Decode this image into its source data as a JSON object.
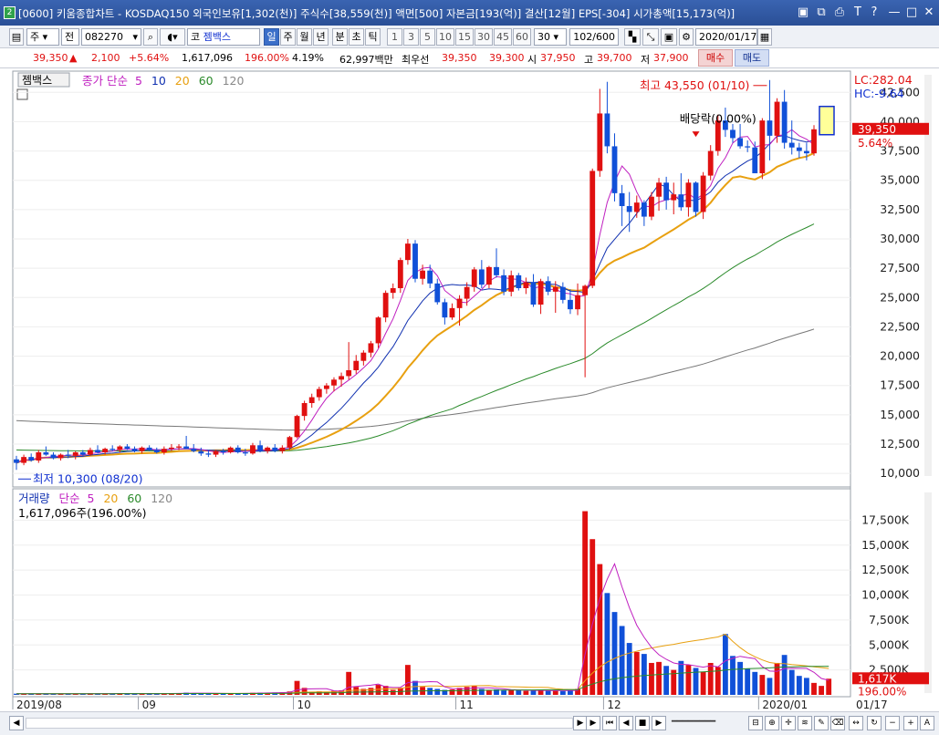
{
  "window": {
    "badge": "2",
    "title": "[0600] 키움종합차트 - KOSDAQ150 외국인보유[1,302(천)] 주식수[38,559(천)] 액면[500] 자본금[193(억)] 결산[12월] EPS[-304] 시가총액[15,173(억)]"
  },
  "toolbar": {
    "period_unit": "주",
    "compare": "전",
    "code": "082270",
    "market": "코",
    "stock_name": "젬백스",
    "periods": [
      "일",
      "주",
      "월",
      "년",
      "분",
      "초",
      "틱"
    ],
    "selected_period": "일",
    "intervals": [
      "1",
      "3",
      "5",
      "10",
      "15",
      "30",
      "45",
      "60"
    ],
    "interval_value": "30",
    "count": "102/600",
    "date": "2020/01/17"
  },
  "quote": {
    "price": "39,350",
    "change": "2,100",
    "change_pct": "+5.64%",
    "volume": "1,617,096",
    "volume_ratio": "196.00%",
    "turnover": "4.19%",
    "amount": "62,997백만",
    "best_bid_label": "최우선",
    "ask": "39,350",
    "bid": "39,300",
    "open_label": "시",
    "open": "37,950",
    "high_label": "고",
    "high": "39,700",
    "low_label": "저",
    "low": "37,900",
    "buy_label": "매수",
    "sell_label": "매도"
  },
  "chart_data": [
    {
      "type": "candlestick",
      "stock_tag": "젬백스",
      "legend": [
        "종가 단순",
        "5",
        "10",
        "20",
        "60",
        "120"
      ],
      "ylim": [
        9000,
        44000
      ],
      "yticks": [
        "10,000",
        "12,500",
        "15,000",
        "17,500",
        "20,000",
        "22,500",
        "25,000",
        "27,500",
        "30,000",
        "32,500",
        "35,000",
        "37,500",
        "40,000",
        "42,500"
      ],
      "lc_label": "LC:282.04",
      "hc_label": "HC:-9.64",
      "price_tag": "39,350",
      "price_tag_pct": "5.64%",
      "max_label": "최고 43,550 (01/10)",
      "min_label": "최저 10,300 (08/20)",
      "dividend_label": "배당락(0.00%)",
      "x_labels": [
        "2019/08",
        "09",
        "10",
        "11",
        "12",
        "2020/01",
        "01/17"
      ],
      "candles": [
        [
          11200,
          11500,
          10300,
          10900
        ],
        [
          10900,
          11600,
          10700,
          11400
        ],
        [
          11400,
          11700,
          11000,
          11100
        ],
        [
          11100,
          12000,
          10900,
          11800
        ],
        [
          11800,
          12300,
          11500,
          11600
        ],
        [
          11600,
          11800,
          11200,
          11300
        ],
        [
          11300,
          11700,
          11100,
          11600
        ],
        [
          11600,
          12000,
          11300,
          11500
        ],
        [
          11500,
          11900,
          11200,
          11800
        ],
        [
          11800,
          12000,
          11500,
          11600
        ],
        [
          11600,
          12200,
          11500,
          12000
        ],
        [
          12000,
          12400,
          11700,
          11800
        ],
        [
          11800,
          12200,
          11600,
          12100
        ],
        [
          12100,
          12400,
          11900,
          12000
        ],
        [
          12000,
          12400,
          11800,
          12300
        ],
        [
          12300,
          12500,
          12000,
          12100
        ],
        [
          12100,
          12300,
          11800,
          11900
        ],
        [
          11900,
          12300,
          11700,
          12200
        ],
        [
          12200,
          12400,
          11900,
          12000
        ],
        [
          12000,
          12200,
          11700,
          11800
        ],
        [
          11800,
          12300,
          11600,
          12100
        ],
        [
          12100,
          12500,
          11900,
          12200
        ],
        [
          12200,
          12500,
          12000,
          12300
        ],
        [
          12300,
          13200,
          12100,
          12100
        ],
        [
          12100,
          12500,
          11800,
          11900
        ],
        [
          11900,
          12200,
          11500,
          11700
        ],
        [
          11700,
          12000,
          11400,
          11600
        ],
        [
          11600,
          12000,
          11400,
          11900
        ],
        [
          11900,
          12100,
          11600,
          11800
        ],
        [
          11800,
          12300,
          11700,
          12200
        ],
        [
          12200,
          12400,
          11700,
          11800
        ],
        [
          11800,
          12100,
          11500,
          11700
        ],
        [
          11700,
          12600,
          11600,
          12400
        ],
        [
          12400,
          12800,
          11800,
          11900
        ],
        [
          11900,
          12300,
          11700,
          12200
        ],
        [
          12200,
          12500,
          11800,
          11900
        ],
        [
          11900,
          12400,
          11700,
          12200
        ],
        [
          12200,
          13200,
          12000,
          13100
        ],
        [
          13100,
          15000,
          13000,
          14900
        ],
        [
          14900,
          16200,
          14500,
          16000
        ],
        [
          16000,
          16800,
          15600,
          16500
        ],
        [
          16500,
          17400,
          16200,
          17200
        ],
        [
          17200,
          17700,
          16800,
          17500
        ],
        [
          17500,
          18200,
          17000,
          18000
        ],
        [
          18000,
          18600,
          17400,
          18300
        ],
        [
          18300,
          21200,
          18000,
          18800
        ],
        [
          18800,
          20100,
          18500,
          19600
        ],
        [
          19600,
          20500,
          19200,
          20300
        ],
        [
          20300,
          21300,
          19900,
          21100
        ],
        [
          21100,
          23400,
          20700,
          23300
        ],
        [
          23300,
          25600,
          22900,
          25400
        ],
        [
          25400,
          26200,
          24900,
          25800
        ],
        [
          25800,
          28400,
          25400,
          28200
        ],
        [
          28200,
          30000,
          27800,
          29600
        ],
        [
          29600,
          29900,
          26300,
          26600
        ],
        [
          26600,
          27800,
          26100,
          27300
        ],
        [
          27300,
          27800,
          25800,
          26200
        ],
        [
          26200,
          26600,
          24400,
          24600
        ],
        [
          24600,
          24900,
          22700,
          23300
        ],
        [
          23300,
          24500,
          23100,
          24100
        ],
        [
          24100,
          25200,
          22600,
          24900
        ],
        [
          24900,
          26300,
          24300,
          25900
        ],
        [
          25900,
          27600,
          25500,
          27400
        ],
        [
          27400,
          28200,
          25800,
          26100
        ],
        [
          26100,
          27700,
          25800,
          27600
        ],
        [
          27600,
          29200,
          26700,
          26900
        ],
        [
          26900,
          27400,
          25200,
          25500
        ],
        [
          25500,
          27300,
          25100,
          26900
        ],
        [
          26900,
          27100,
          25600,
          25800
        ],
        [
          25800,
          26700,
          25300,
          26300
        ],
        [
          26300,
          27000,
          24200,
          24400
        ],
        [
          24400,
          26600,
          23600,
          26400
        ],
        [
          26400,
          26800,
          25200,
          25500
        ],
        [
          25500,
          26400,
          23700,
          25900
        ],
        [
          25900,
          26300,
          24500,
          24800
        ],
        [
          24800,
          25700,
          23600,
          24000
        ],
        [
          24000,
          26200,
          23500,
          25200
        ],
        [
          25200,
          26100,
          18200,
          26000
        ],
        [
          26000,
          36000,
          25800,
          35800
        ],
        [
          35800,
          42800,
          35300,
          40700
        ],
        [
          40700,
          43400,
          37300,
          37900
        ],
        [
          37900,
          39000,
          33200,
          33900
        ],
        [
          33900,
          34600,
          31100,
          32800
        ],
        [
          32800,
          34000,
          30600,
          32300
        ],
        [
          32300,
          33700,
          31800,
          33100
        ],
        [
          33100,
          33300,
          31100,
          31900
        ],
        [
          31900,
          34000,
          31600,
          33600
        ],
        [
          33600,
          35200,
          32400,
          34800
        ],
        [
          34800,
          35300,
          32500,
          33300
        ],
        [
          33300,
          34800,
          32100,
          33800
        ],
        [
          33800,
          35600,
          32400,
          32700
        ],
        [
          32700,
          35100,
          31900,
          34800
        ],
        [
          34800,
          34900,
          31900,
          32300
        ],
        [
          32300,
          35700,
          31700,
          35400
        ],
        [
          35400,
          38000,
          35000,
          37500
        ],
        [
          37500,
          40600,
          37100,
          40100
        ],
        [
          40100,
          41200,
          38700,
          39300
        ],
        [
          39300,
          39800,
          38200,
          38600
        ],
        [
          38600,
          39800,
          37700,
          37900
        ],
        [
          37900,
          38400,
          37400,
          37800
        ],
        [
          37800,
          38300,
          35600,
          35600
        ],
        [
          35600,
          40300,
          35100,
          40100
        ],
        [
          40100,
          43550,
          36700,
          38800
        ],
        [
          38800,
          42000,
          38200,
          41700
        ],
        [
          41700,
          42700,
          37700,
          38200
        ],
        [
          38200,
          40100,
          37200,
          37800
        ],
        [
          37800,
          38200,
          36900,
          37500
        ],
        [
          37500,
          38200,
          36700,
          37300
        ],
        [
          37300,
          39700,
          37100,
          39350
        ]
      ]
    },
    {
      "type": "bar",
      "legend": [
        "거래량",
        "단순",
        "5",
        "20",
        "60",
        "120"
      ],
      "volume_text": "1,617,096주(196.00%)",
      "ylim": [
        0,
        19000
      ],
      "yticks": [
        "2,500K",
        "5,000K",
        "7,500K",
        "10,000K",
        "12,500K",
        "15,000K",
        "17,500K"
      ],
      "vol_tag": "1,617K",
      "vol_tag_pct": "196.00%",
      "volumes": [
        120,
        100,
        110,
        130,
        150,
        120,
        100,
        110,
        120,
        100,
        160,
        140,
        130,
        110,
        150,
        140,
        120,
        130,
        140,
        110,
        150,
        160,
        180,
        220,
        170,
        150,
        130,
        140,
        120,
        150,
        140,
        160,
        210,
        230,
        220,
        240,
        260,
        340,
        1400,
        700,
        300,
        350,
        320,
        400,
        450,
        2300,
        800,
        600,
        700,
        1000,
        900,
        500,
        700,
        3000,
        1400,
        800,
        700,
        600,
        500,
        550,
        700,
        800,
        900,
        600,
        500,
        550,
        450,
        500,
        450,
        400,
        450,
        500,
        400,
        400,
        380,
        450,
        600,
        18400,
        15600,
        13100,
        10200,
        8300,
        6900,
        5200,
        4300,
        4100,
        3200,
        3300,
        2900,
        2500,
        3400,
        3000,
        2700,
        2300,
        3200,
        2800,
        6100,
        3900,
        3300,
        2600,
        2300,
        2000,
        1700,
        3200,
        4000,
        2500,
        1900,
        1700,
        1200,
        900,
        1617
      ]
    }
  ],
  "scrollbar": {
    "icons": [
      "play-icon",
      "first-icon",
      "prev-icon",
      "stop-icon",
      "next-icon",
      "last-icon"
    ]
  }
}
